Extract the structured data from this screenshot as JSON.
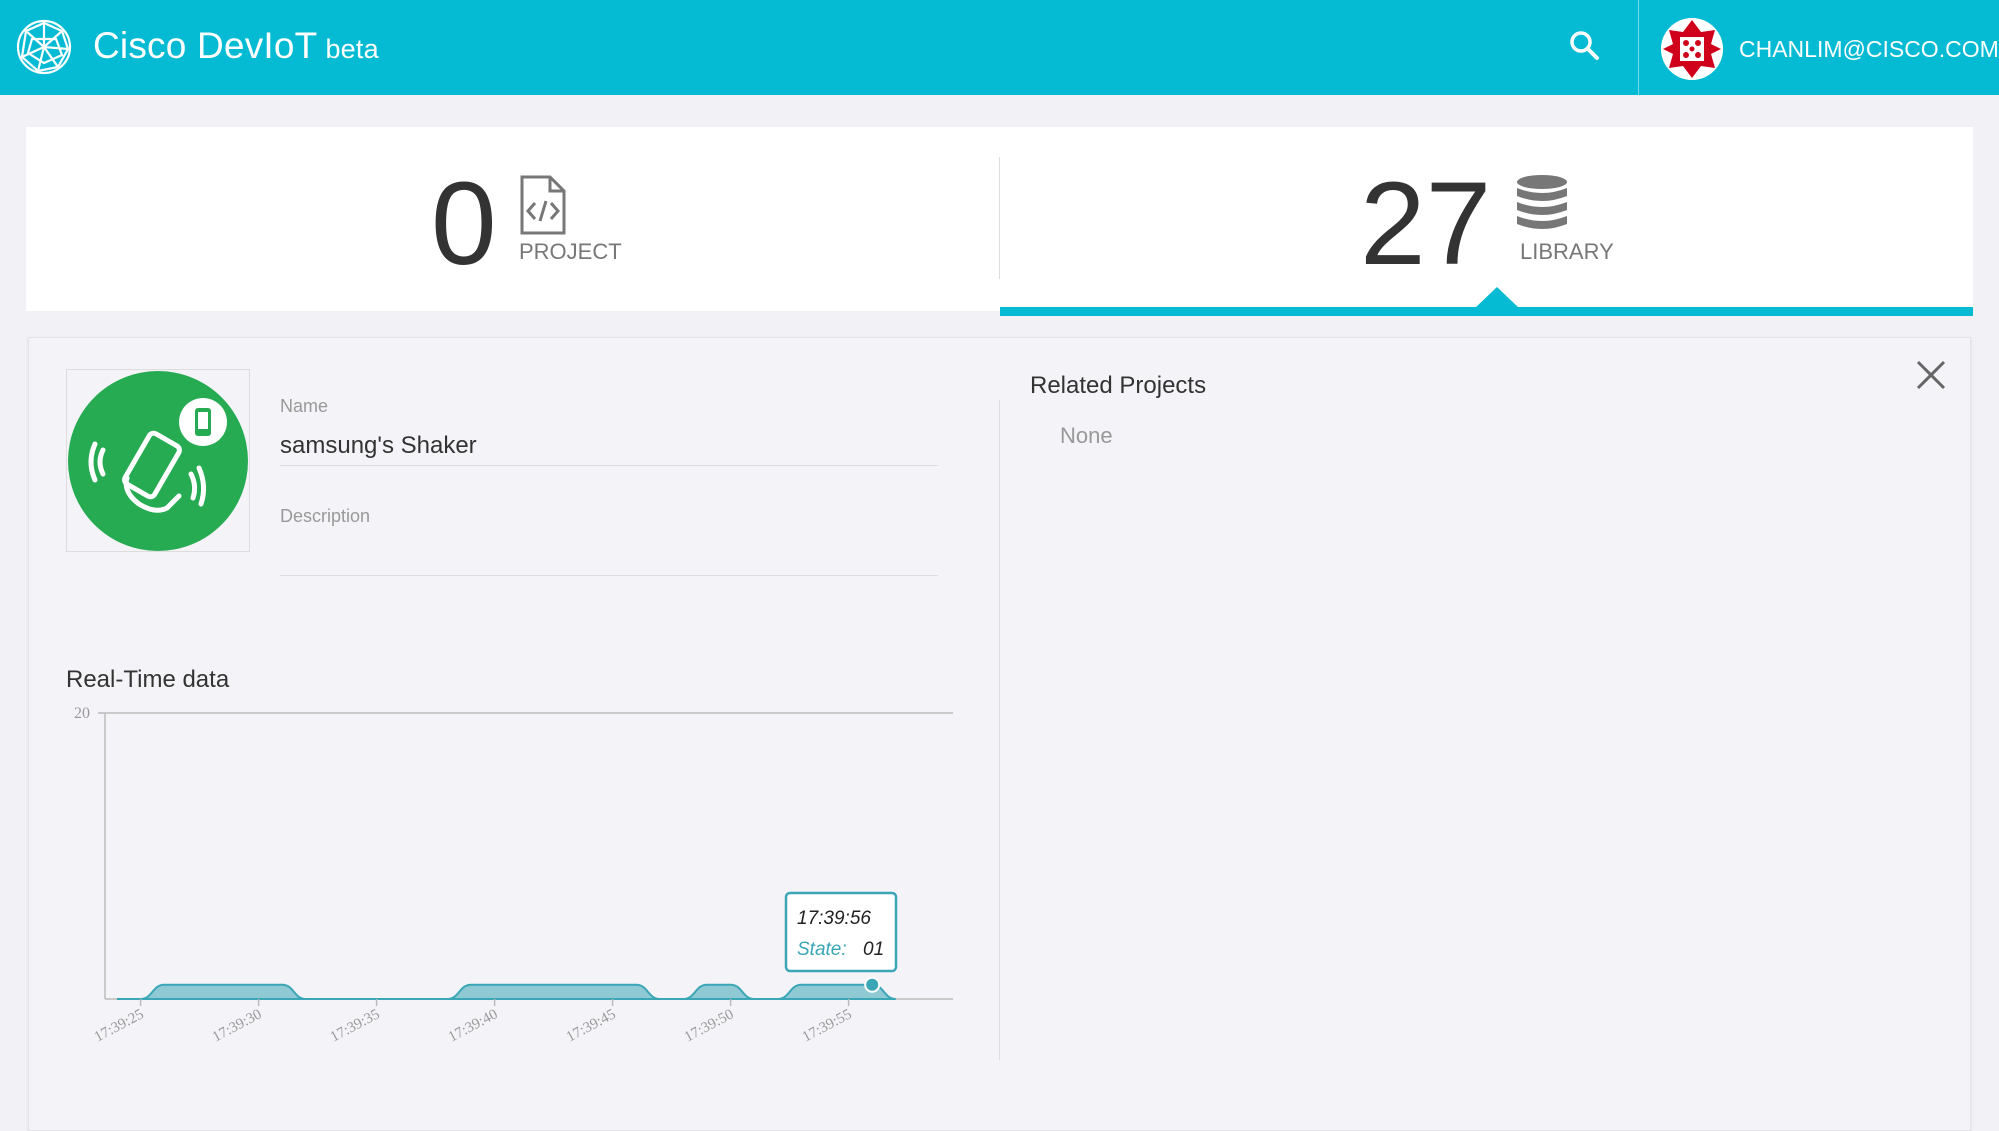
{
  "header": {
    "brand": "Cisco DevIoT",
    "beta": "beta",
    "user_email": "CHANLIM@CISCO.COM",
    "colors": {
      "bar": "#04bbd3",
      "text": "#ffffff"
    },
    "icons": [
      "network-globe-icon",
      "search-icon",
      "user-avatar-icon"
    ]
  },
  "stats": {
    "project": {
      "count": "0",
      "label": "PROJECT",
      "icon": "code-file-icon"
    },
    "library": {
      "count": "27",
      "label": "LIBRARY",
      "icon": "database-icon",
      "active": true
    }
  },
  "detail": {
    "thumbnail_icon": "shaking-phone-icon",
    "name_label": "Name",
    "name_value": "samsung's Shaker",
    "description_label": "Description",
    "description_value": "",
    "realtime_title": "Real-Time data",
    "related_title": "Related Projects",
    "related_value": "None",
    "close_icon": "close-icon"
  },
  "chart_data": {
    "type": "area",
    "title": "",
    "ylim": [
      0,
      20
    ],
    "y_ticks": [
      "20"
    ],
    "x_ticks": [
      "17:39:25",
      "17:39:30",
      "17:39:35",
      "17:39:40",
      "17:39:45",
      "17:39:50",
      "17:39:55"
    ],
    "series": [
      {
        "color": "#3aa6b6",
        "x": [
          "17:39:24",
          "17:39:25",
          "17:39:26",
          "17:39:27",
          "17:39:28",
          "17:39:29",
          "17:39:30",
          "17:39:31",
          "17:39:32",
          "17:39:33",
          "17:39:34",
          "17:39:35",
          "17:39:36",
          "17:39:37",
          "17:39:38",
          "17:39:39",
          "17:39:40",
          "17:39:41",
          "17:39:42",
          "17:39:43",
          "17:39:44",
          "17:39:45",
          "17:39:46",
          "17:39:47",
          "17:39:48",
          "17:39:49",
          "17:39:50",
          "17:39:51",
          "17:39:52",
          "17:39:53",
          "17:39:54",
          "17:39:55",
          "17:39:56",
          "17:39:57"
        ],
        "values": [
          0,
          0,
          1,
          1,
          1,
          1,
          1,
          1,
          0,
          0,
          0,
          0,
          0,
          0,
          0,
          1,
          1,
          1,
          1,
          1,
          1,
          1,
          1,
          0,
          0,
          1,
          1,
          0,
          0,
          1,
          1,
          1,
          1,
          0
        ]
      }
    ],
    "tooltip": {
      "time": "17:39:56",
      "label": "State:",
      "value": "01"
    }
  }
}
